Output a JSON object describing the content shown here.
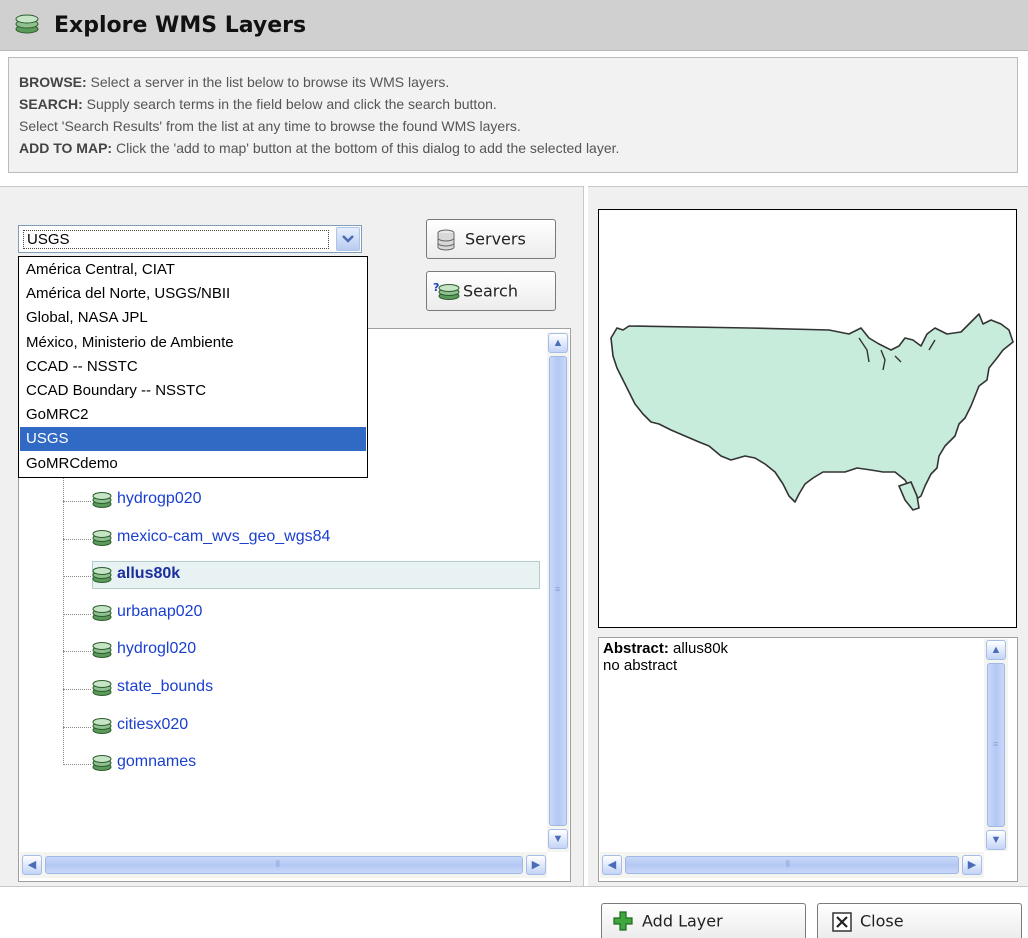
{
  "window": {
    "title": "Explore WMS Layers",
    "icon": "layers-icon"
  },
  "instructions": [
    {
      "label": "BROWSE:",
      "text": " Select a server in the list below to browse its WMS layers."
    },
    {
      "label": "SEARCH:",
      "text": " Supply search terms in the field below and click the search button."
    },
    {
      "label": "",
      "text": "Select 'Search Results' from the list at any time to browse the found WMS layers."
    },
    {
      "label": "ADD TO MAP:",
      "text": " Click the 'add to map' button at the bottom of this dialog to add the selected layer."
    }
  ],
  "server_select": {
    "value": "USGS",
    "options": [
      "América Central, CIAT",
      "América del Norte, USGS/NBII",
      "Global, NASA JPL",
      "México, Ministerio de Ambiente",
      "CCAD -- NSSTC",
      "CCAD Boundary -- NSSTC",
      "GoMRC2",
      "USGS",
      "GoMRCdemo"
    ],
    "highlighted": "USGS"
  },
  "buttons": {
    "servers": "Servers",
    "search": "Search",
    "add_layer": "Add Layer",
    "close": "Close"
  },
  "tree": {
    "layers": [
      "hydrogp020",
      "mexico-cam_wvs_geo_wgs84",
      "allus80k",
      "urbanap020",
      "hydrogl020",
      "state_bounds",
      "citiesx020",
      "gomnames"
    ],
    "selected": "allus80k"
  },
  "abstract": {
    "label": "Abstract:",
    "layer": " allus80k",
    "text": "no abstract"
  },
  "colors": {
    "map_fill": "#c8ecdc",
    "selection": "#316ac5",
    "link": "#1a3fd0"
  }
}
